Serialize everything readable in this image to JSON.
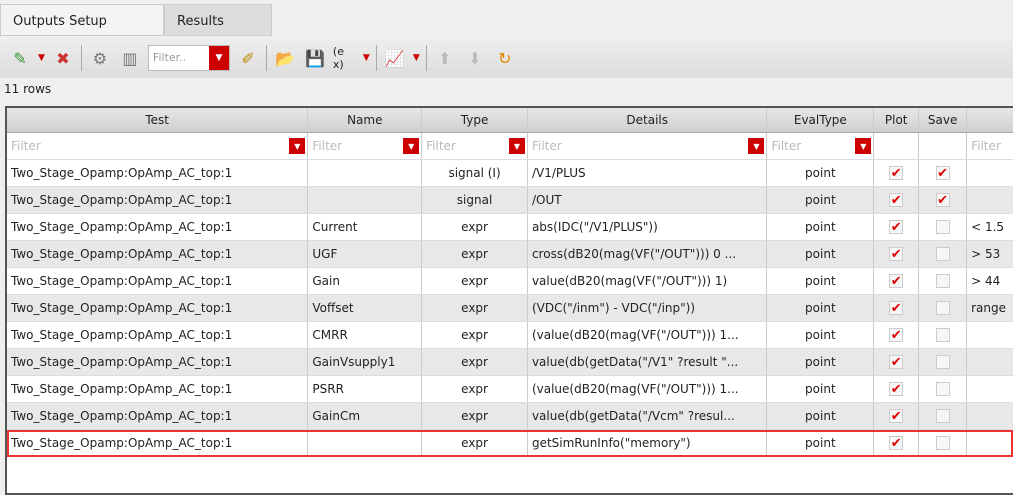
{
  "tabs": [
    {
      "label": "Outputs Setup",
      "active": true
    },
    {
      "label": "Results",
      "active": false
    }
  ],
  "toolbar": {
    "filter_placeholder": "Filter..",
    "icons": [
      "add-output-icon",
      "delete-icon",
      "settings-icon",
      "columns-icon",
      "filter-dropdown",
      "edit-icon",
      "open-folder-icon",
      "save-icon",
      "expression-icon",
      "plot-icon",
      "move-up-icon",
      "move-down-icon",
      "refresh-icon"
    ]
  },
  "row_count": "11 rows",
  "filter_placeholder": "Filter",
  "columns": [
    "Test",
    "Name",
    "Type",
    "Details",
    "EvalType",
    "Plot",
    "Save",
    ""
  ],
  "rows": [
    {
      "test": "Two_Stage_Opamp:OpAmp_AC_top:1",
      "name": "",
      "type": "signal (I)",
      "details": "/V1/PLUS",
      "eval": "point",
      "plot": true,
      "save": true,
      "spec": ""
    },
    {
      "test": "Two_Stage_Opamp:OpAmp_AC_top:1",
      "name": "",
      "type": "signal",
      "details": "/OUT",
      "eval": "point",
      "plot": true,
      "save": true,
      "spec": ""
    },
    {
      "test": "Two_Stage_Opamp:OpAmp_AC_top:1",
      "name": "Current",
      "type": "expr",
      "details": "abs(IDC(\"/V1/PLUS\"))",
      "eval": "point",
      "plot": true,
      "save": false,
      "spec": "< 1.5"
    },
    {
      "test": "Two_Stage_Opamp:OpAmp_AC_top:1",
      "name": "UGF",
      "type": "expr",
      "details": "cross(dB20(mag(VF(\"/OUT\"))) 0 ...",
      "eval": "point",
      "plot": true,
      "save": false,
      "spec": "> 53"
    },
    {
      "test": "Two_Stage_Opamp:OpAmp_AC_top:1",
      "name": "Gain",
      "type": "expr",
      "details": "value(dB20(mag(VF(\"/OUT\"))) 1)",
      "eval": "point",
      "plot": true,
      "save": false,
      "spec": "> 44"
    },
    {
      "test": "Two_Stage_Opamp:OpAmp_AC_top:1",
      "name": "Voffset",
      "type": "expr",
      "details": "(VDC(\"/inm\") - VDC(\"/inp\"))",
      "eval": "point",
      "plot": true,
      "save": false,
      "spec": "range"
    },
    {
      "test": "Two_Stage_Opamp:OpAmp_AC_top:1",
      "name": "CMRR",
      "type": "expr",
      "details": "(value(dB20(mag(VF(\"/OUT\"))) 1...",
      "eval": "point",
      "plot": true,
      "save": false,
      "spec": ""
    },
    {
      "test": "Two_Stage_Opamp:OpAmp_AC_top:1",
      "name": "GainVsupply1",
      "type": "expr",
      "details": "value(db(getData(\"/V1\" ?result \"...",
      "eval": "point",
      "plot": true,
      "save": false,
      "spec": ""
    },
    {
      "test": "Two_Stage_Opamp:OpAmp_AC_top:1",
      "name": "PSRR",
      "type": "expr",
      "details": "(value(dB20(mag(VF(\"/OUT\"))) 1...",
      "eval": "point",
      "plot": true,
      "save": false,
      "spec": ""
    },
    {
      "test": "Two_Stage_Opamp:OpAmp_AC_top:1",
      "name": "GainCm",
      "type": "expr",
      "details": "value(db(getData(\"/Vcm\" ?resul...",
      "eval": "point",
      "plot": true,
      "save": false,
      "spec": ""
    },
    {
      "test": "Two_Stage_Opamp:OpAmp_AC_top:1",
      "name": "",
      "type": "expr",
      "details": "getSimRunInfo(\"memory\")",
      "eval": "point",
      "plot": true,
      "save": false,
      "spec": "",
      "selected": true
    }
  ],
  "colors": {
    "accent": "#cc0000",
    "selection": "#ee3333"
  }
}
